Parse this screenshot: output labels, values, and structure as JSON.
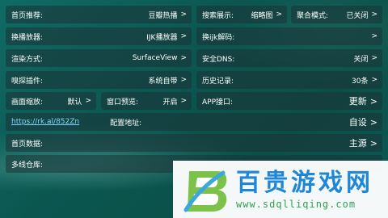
{
  "rows": {
    "home_recommend": {
      "label": "首页推荐:",
      "value": "豆瓣热播",
      "arrow": ">"
    },
    "search_display": {
      "label": "搜索展示:",
      "value": "缩略图",
      "arrow": ">"
    },
    "aggregate_mode": {
      "label": "聚合模式:",
      "value": "已关闭",
      "arrow": ">"
    },
    "player": {
      "label": "换播放器:",
      "value": "IJK播放器",
      "arrow": ">"
    },
    "ijk_decode": {
      "label": "换ijk解码:",
      "value": "",
      "arrow": ">"
    },
    "render_mode": {
      "label": "渲染方式:",
      "value": "SurfaceView",
      "arrow": ">"
    },
    "secure_dns": {
      "label": "安全DNS:",
      "value": "关闭",
      "arrow": ">"
    },
    "sniff_plugin": {
      "label": "嗅探插件:",
      "value": "系统自带",
      "arrow": ">"
    },
    "history": {
      "label": "历史记录:",
      "value": "30条",
      "arrow": ">"
    },
    "screen_scale": {
      "label": "画面缩放:",
      "value": "默认",
      "arrow": ">"
    },
    "window_preview": {
      "label": "窗口预览:",
      "value": "开启",
      "arrow": ">"
    },
    "app_api": {
      "label": "APP接口:",
      "value": "更新",
      "arrow": ">"
    },
    "config_addr": {
      "link": "https://rk.al/852Zn",
      "label": "配置地址:",
      "value": "自设",
      "arrow": ">"
    },
    "home_data": {
      "label": "首页数据:",
      "value": "主源",
      "arrow": ">"
    },
    "multi_repo": {
      "label": "多线仓库:",
      "value": "",
      "arrow": ""
    }
  },
  "watermark": {
    "title": "百贵游戏网",
    "url": "www.sdqlliqing.com",
    "logo_letter": "B"
  },
  "colors": {
    "background": "#0b5750",
    "cell": "#1e3237",
    "link": "#7fd6ff",
    "watermark_title": "#1f87d6",
    "watermark_url": "#2fa050"
  }
}
